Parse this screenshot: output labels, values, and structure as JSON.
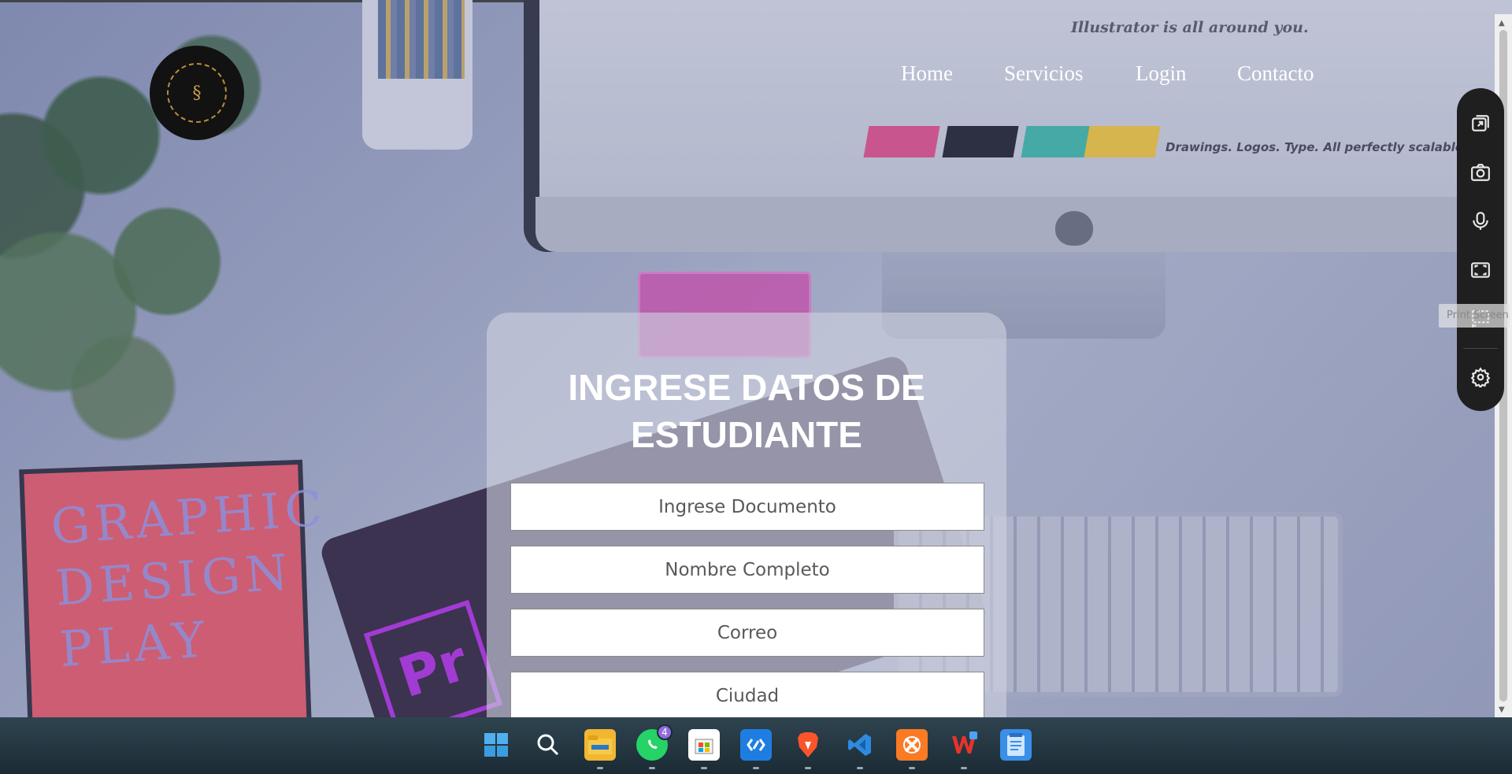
{
  "nav": {
    "logo_alt": "SS logo",
    "links": [
      "Home",
      "Servicios",
      "Login",
      "Contacto"
    ]
  },
  "background": {
    "monitor_headline": "Illustrator is all around you.",
    "monitor_tagline": "Drawings. Logos. Type. All perfectly scalable.",
    "notebook_text": "GRAPHIC DESIGN PLAY"
  },
  "form": {
    "title": "INGRESE DATOS DE ESTUDIANTE",
    "fields": [
      {
        "placeholder": "Ingrese Documento",
        "value": ""
      },
      {
        "placeholder": "Nombre Completo",
        "value": ""
      },
      {
        "placeholder": "Correo",
        "value": ""
      },
      {
        "placeholder": "Ciudad",
        "value": ""
      }
    ]
  },
  "side_toolbar": {
    "buttons": [
      "cast-icon",
      "camera-icon",
      "microphone-icon",
      "fullscreen-capture-icon",
      "region-capture-icon",
      "settings-icon"
    ],
    "tooltip": "Print Screen"
  },
  "taskbar": {
    "apps": [
      "Start",
      "Search",
      "File Explorer",
      "WhatsApp",
      "Microsoft Store",
      "Remote Desktop",
      "Brave",
      "Visual Studio Code",
      "XAMPP",
      "WPS Office",
      "Notepad"
    ],
    "whatsapp_badge": "4"
  },
  "colors": {
    "nav_text": "#ffffff",
    "card_bg": "rgba(205,208,222,0.62)",
    "sidebar_bg": "#1f1f1f",
    "taskbar_bg": "#1b2b34"
  }
}
